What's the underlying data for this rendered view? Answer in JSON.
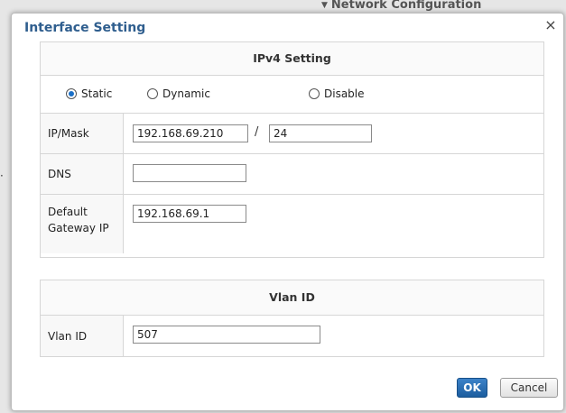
{
  "background": {
    "nav_label": "Network Configuration",
    "nav_icon": "triangle-down-icon"
  },
  "dialog": {
    "title": "Interface Setting",
    "close_glyph": "×"
  },
  "ipv4": {
    "header": "IPv4 Setting",
    "modes": [
      {
        "label": "Static",
        "checked": true
      },
      {
        "label": "Dynamic",
        "checked": false
      },
      {
        "label": "Disable",
        "checked": false
      }
    ],
    "ip_mask_label": "IP/Mask",
    "ip_value": "192.168.69.210",
    "mask_separator": "/",
    "mask_value": "24",
    "dns_label": "DNS",
    "dns_value": "",
    "gateway_label_line1": "Default",
    "gateway_label_line2": "Gateway IP",
    "gateway_value": "192.168.69.1"
  },
  "vlan": {
    "header": "Vlan ID",
    "label": "Vlan ID",
    "value": "507"
  },
  "buttons": {
    "ok": "OK",
    "cancel": "Cancel"
  },
  "colors": {
    "title": "#2f5e8e",
    "radio_selected": "#1a6fc7",
    "ok_button": "#2a6fb5"
  }
}
